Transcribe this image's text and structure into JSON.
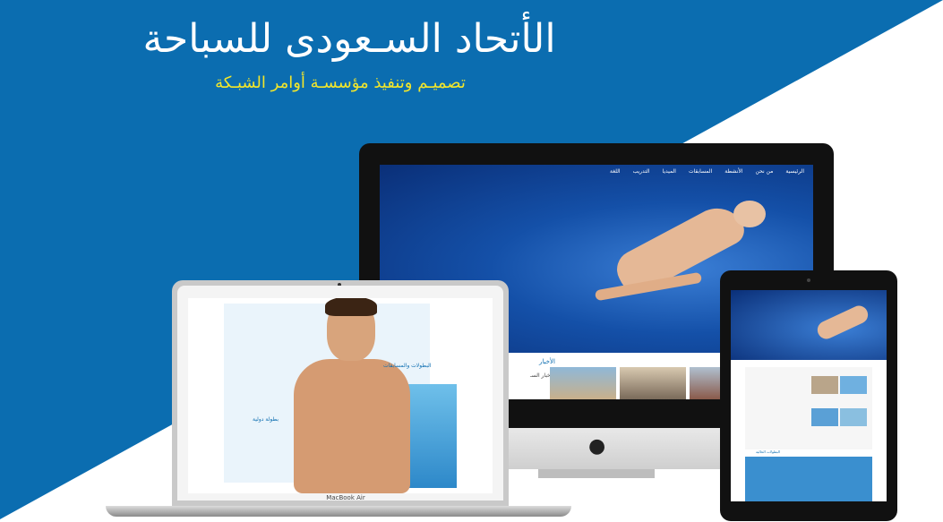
{
  "hero": {
    "title": "الأتحاد السـعودى للسباحة",
    "subtitle": "تصميـم وتنفيذ مؤسسـة أوامر الشبـكة"
  },
  "imac_site": {
    "nav": [
      "الرئيسية",
      "من نحن",
      "الأنشطة",
      "المسابقات",
      "الميديا",
      "التدريب",
      "اللغة"
    ],
    "news_title": "الأخبار",
    "news_heading": "الأخبار السـ"
  },
  "macbook": {
    "brand": "MacBook Air",
    "block1_title": "البطولات والمسابقات",
    "block2_title": "بطولة دولية"
  },
  "ipad_site": {
    "caption": "البطولات الحالية"
  },
  "colors": {
    "brand_blue": "#0b6db0",
    "accent_yellow": "#f2e62b"
  },
  "icons": [
    "apple-logo-icon"
  ]
}
